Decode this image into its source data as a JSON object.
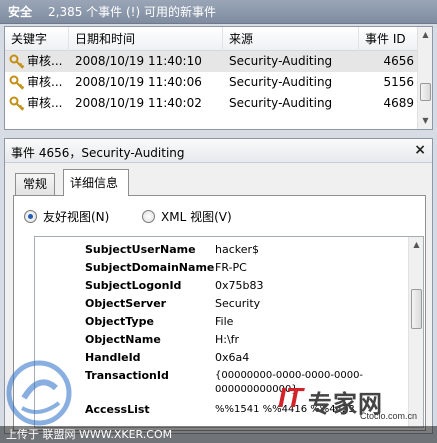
{
  "summary": {
    "title": "安全",
    "count_text": "2,385 个事件 (!) 可用的新事件"
  },
  "list": {
    "columns": [
      "关键字",
      "日期和时间",
      "来源",
      "事件 ID"
    ],
    "rows": [
      {
        "keyword": "审核...",
        "datetime": "2008/10/19 11:40:10",
        "source": "Security-Auditing",
        "event_id": "4656"
      },
      {
        "keyword": "审核...",
        "datetime": "2008/10/19 11:40:06",
        "source": "Security-Auditing",
        "event_id": "5156"
      },
      {
        "keyword": "审核...",
        "datetime": "2008/10/19 11:40:02",
        "source": "Security-Auditing",
        "event_id": "4689"
      }
    ],
    "scroll_up": "▲",
    "scroll_down": "▼"
  },
  "detail": {
    "title": "事件 4656，Security-Auditing",
    "close": "×",
    "tabs": [
      "常规",
      "详细信息"
    ],
    "views": [
      "友好视图(N)",
      "XML 视图(V)"
    ],
    "fields": [
      {
        "key": "SubjectUserName",
        "value": "hacker$"
      },
      {
        "key": "SubjectDomainName",
        "value": "FR-PC"
      },
      {
        "key": "SubjectLogonId",
        "value": "0x75b83"
      },
      {
        "key": "ObjectServer",
        "value": "Security"
      },
      {
        "key": "ObjectType",
        "value": "File"
      },
      {
        "key": "ObjectName",
        "value": "H:\\fr"
      },
      {
        "key": "HandleId",
        "value": "0x6a4"
      },
      {
        "key": "TransactionId",
        "value": "{00000000-0000-0000-0000-"
      },
      {
        "key": "",
        "value": "000000000000}"
      },
      {
        "key": "AccessList",
        "value": "%%1541 %%4416 %%4423"
      }
    ],
    "scroll_up": "▲"
  },
  "watermark": {
    "bottom_text": "上传于 联盟网 WWW.XKER.COM",
    "brand_it": "IT",
    "brand_name": "专家网",
    "brand_url": "Ctocio.com.cn"
  },
  "colors": {
    "selected_row": "#e6e6e6",
    "brand_red": "#d2232a",
    "key_icon": "#d8a520"
  },
  "icons": {
    "key": "key-icon"
  }
}
